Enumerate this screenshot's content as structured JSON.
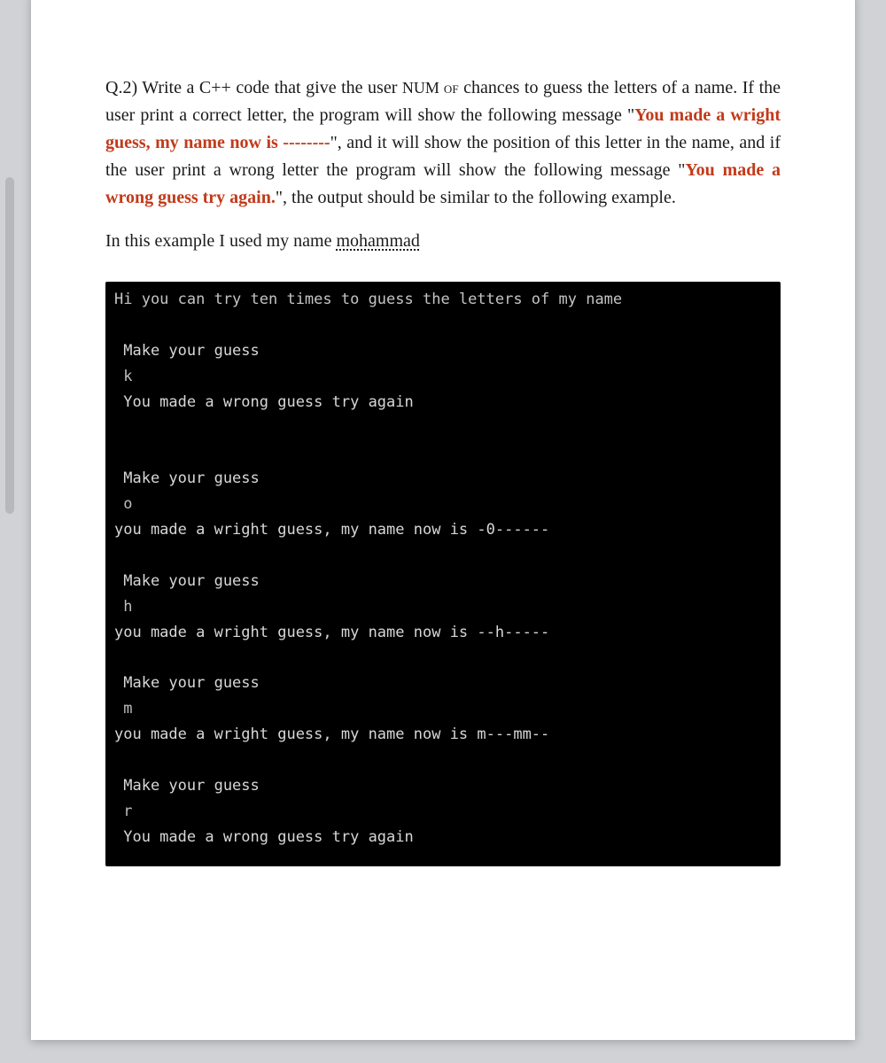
{
  "question": {
    "prefix": "Q.2) Write a C++ code that give the user ",
    "numof": "NUM of",
    "part1b": " chances to guess the letters of a name. If the user print a correct letter, the program will show the following message \"",
    "red1": "You made a wright guess, my name now is --------",
    "part2": "\", and it will show the position of this letter in the name, and if the user print a wrong letter the program will show the following message \"",
    "red2": "You made a wrong guess try again.",
    "part3": "\", the output should be similar to the following example."
  },
  "example_note": {
    "prefix": "In this example I used my name ",
    "name": "mohammad"
  },
  "terminal": {
    "header": "Hi you can try ten times to guess the letters of my name",
    "blocks": [
      {
        "prompt": " Make your guess",
        "input": " k",
        "result": " You made a wrong guess try again"
      },
      {
        "prompt": " Make your guess",
        "input": " o",
        "result": "you made a wright guess, my name now is -0------"
      },
      {
        "prompt": " Make your guess",
        "input": " h",
        "result": "you made a wright guess, my name now is --h-----"
      },
      {
        "prompt": " Make your guess",
        "input": " m",
        "result": "you made a wright guess, my name now is m---mm--"
      },
      {
        "prompt": " Make your guess",
        "input": " r",
        "result": " You made a wrong guess try again"
      }
    ]
  }
}
